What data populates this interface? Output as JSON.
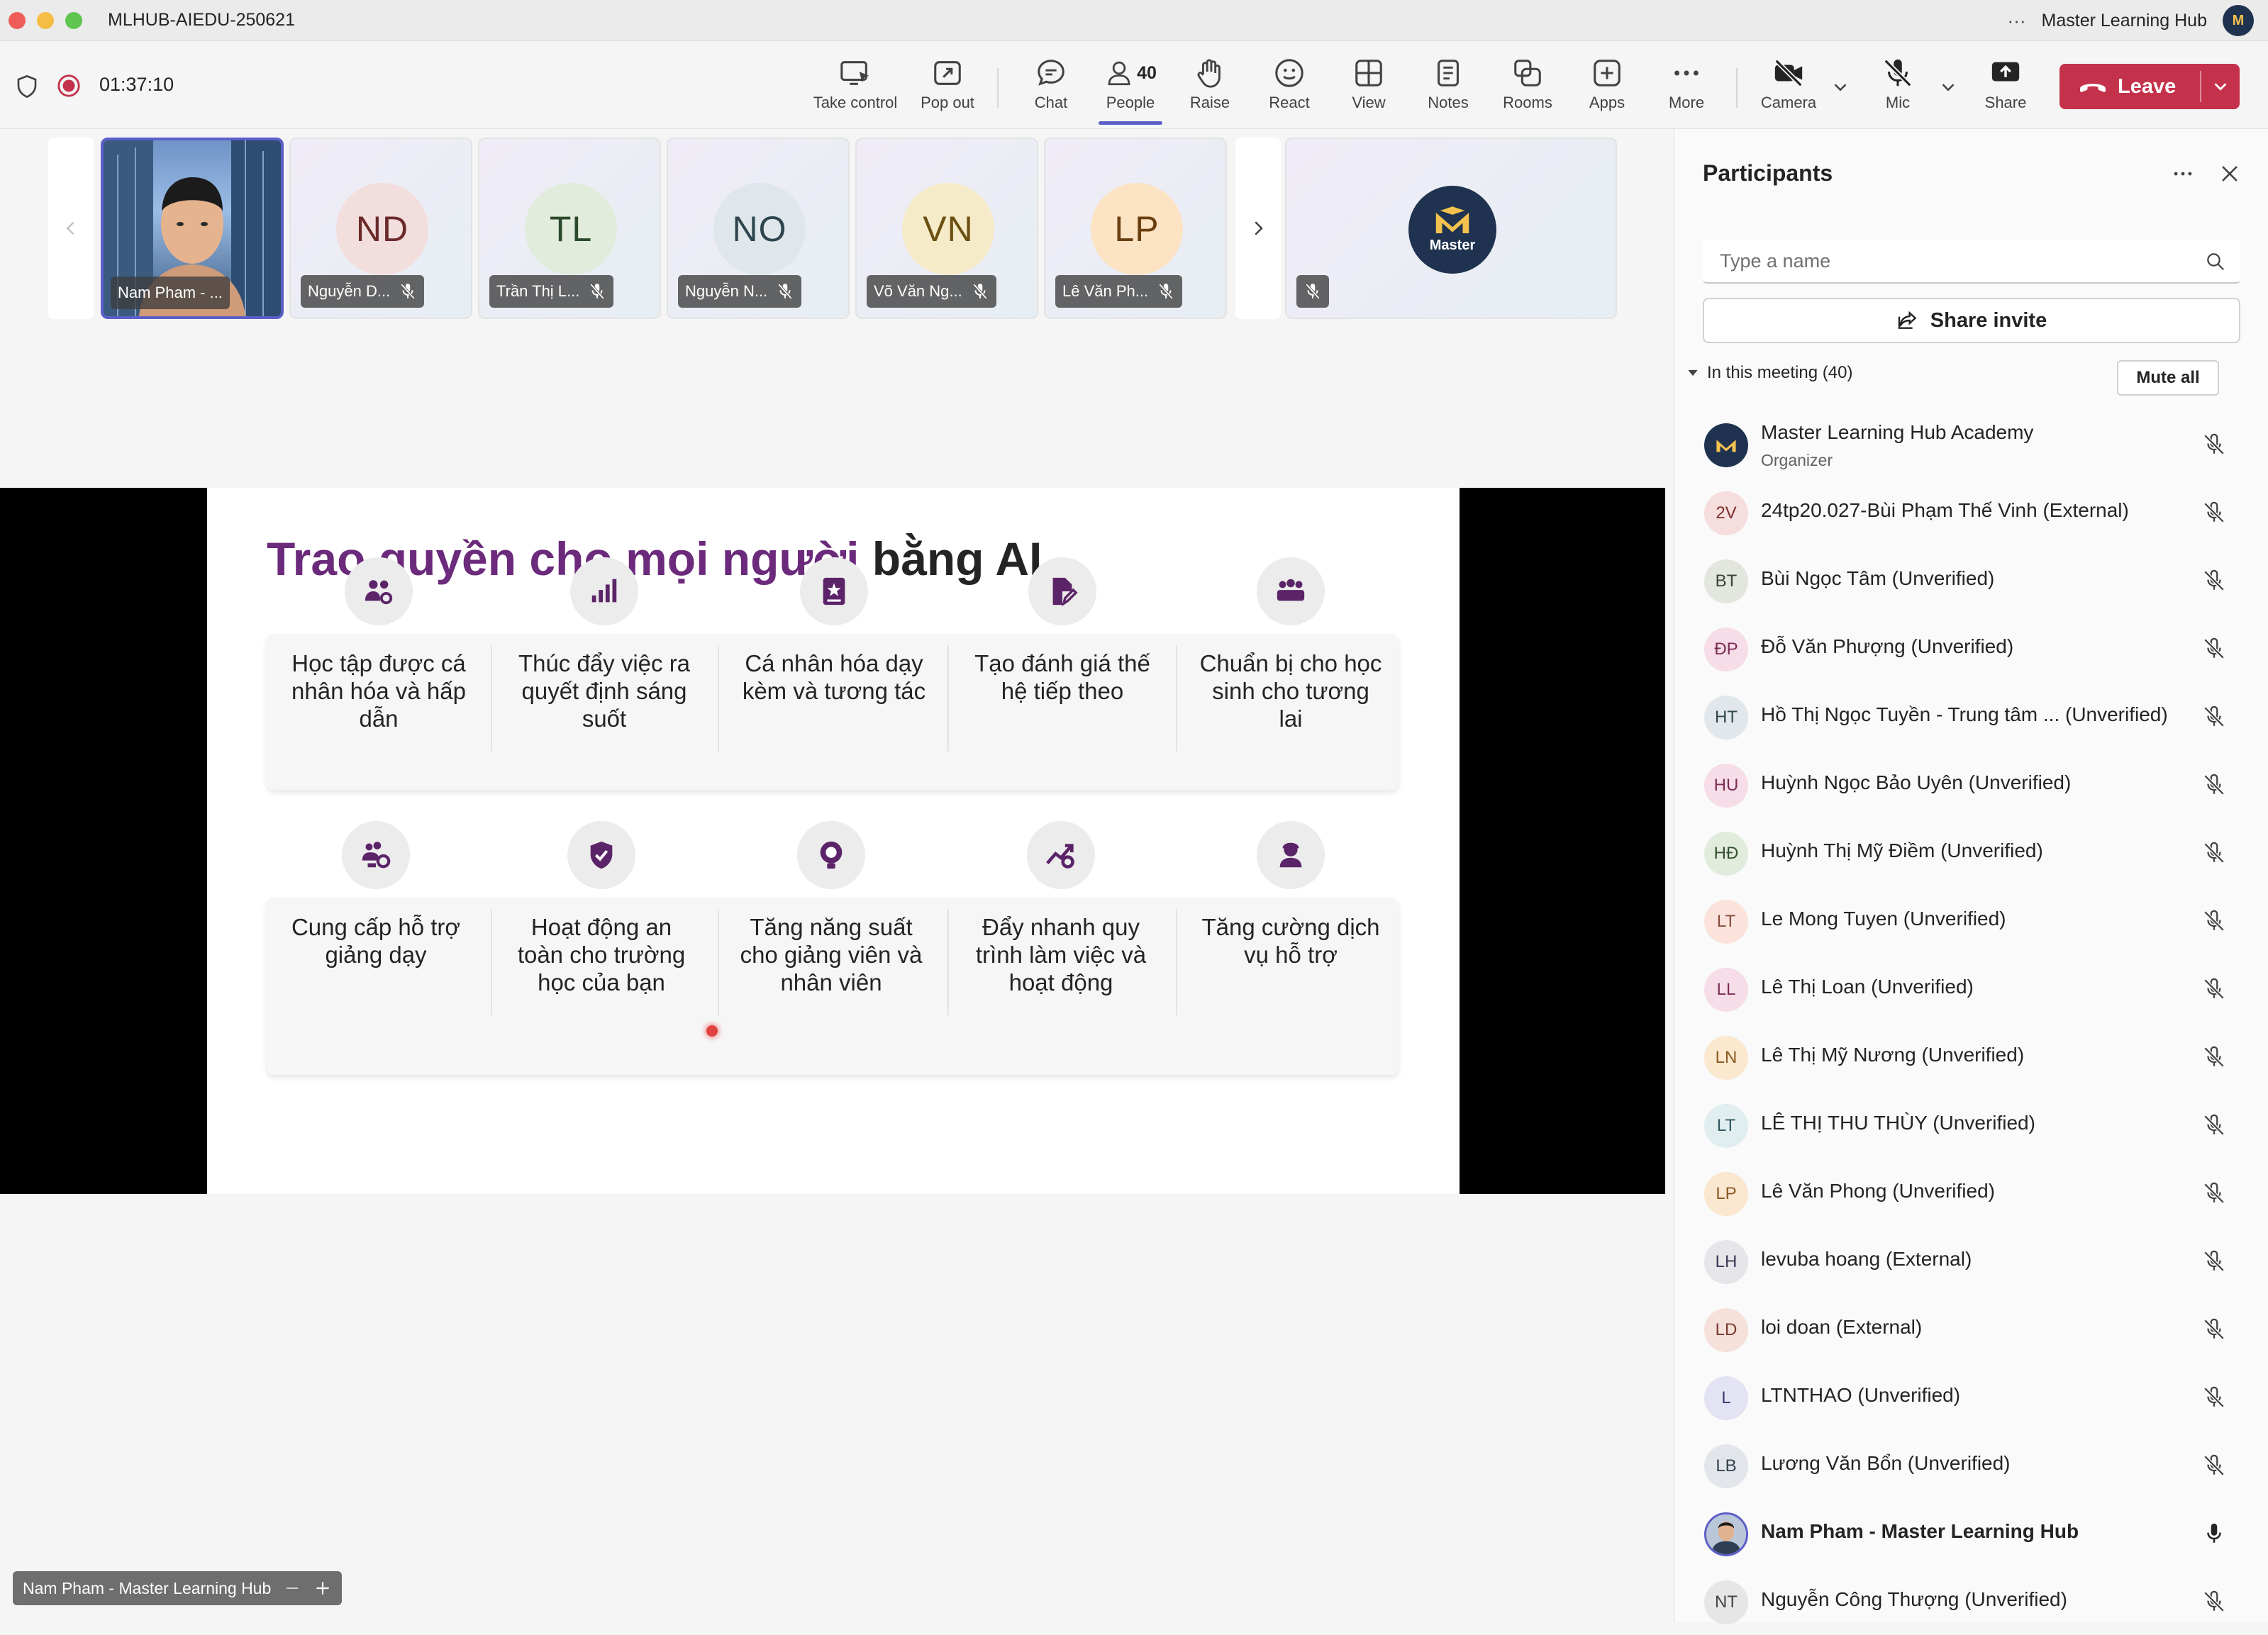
{
  "window": {
    "title": "MLHUB-AIEDU-250621",
    "org_name": "Master Learning Hub",
    "more_glyph": "···"
  },
  "toolbar": {
    "timer": "01:37:10",
    "people_count": "40",
    "buttons": {
      "take_control": "Take control",
      "pop_out": "Pop out",
      "chat": "Chat",
      "people": "People",
      "raise": "Raise",
      "react": "React",
      "view": "View",
      "notes": "Notes",
      "rooms": "Rooms",
      "apps": "Apps",
      "more": "More",
      "camera": "Camera",
      "mic": "Mic",
      "share": "Share"
    },
    "leave_label": "Leave",
    "colors": {
      "leave": "#c4314b",
      "accent": "#5b5fc7"
    }
  },
  "gallery": {
    "tiles": [
      {
        "initials": "",
        "name": "Nam Pham - ...",
        "video": true
      },
      {
        "initials": "ND",
        "name": "Nguyễn D...",
        "bg": "#f3dede",
        "fg": "#6b2a2a"
      },
      {
        "initials": "TL",
        "name": "Trần Thị L...",
        "bg": "#e2ecdd",
        "fg": "#2b4a2b"
      },
      {
        "initials": "NO",
        "name": "Nguyễn N...",
        "bg": "#dfe7ea",
        "fg": "#2f4550"
      },
      {
        "initials": "VN",
        "name": "Võ Văn Ng...",
        "bg": "#f6ebc9",
        "fg": "#6a4f10"
      },
      {
        "initials": "LP",
        "name": "Lê Văn Ph...",
        "bg": "#fbe3c4",
        "fg": "#6b3f10"
      }
    ],
    "logo_text": "Master"
  },
  "slide": {
    "title_purple": "Trao quyền cho mọi người",
    "title_dark": "bằng AI",
    "row1": [
      {
        "icon": "people-gear-icon",
        "label": "Học tập được cá nhân hóa và hấp dẫn"
      },
      {
        "icon": "bar-chart-icon",
        "label": "Thúc đẩy việc ra quyết định sáng suốt"
      },
      {
        "icon": "book-star-icon",
        "label": "Cá nhân hóa dạy kèm và tương tác"
      },
      {
        "icon": "document-edit-icon",
        "label": "Tạo đánh giá thế hệ tiếp theo"
      },
      {
        "icon": "group-icon",
        "label": "Chuẩn bị cho học sinh cho tương lai"
      }
    ],
    "row2": [
      {
        "icon": "people-settings-icon",
        "label": "Cung cấp hỗ trợ giảng dạy"
      },
      {
        "icon": "shield-check-icon",
        "label": "Hoạt động an toàn cho trường học của bạn"
      },
      {
        "icon": "lightbulb-icon",
        "label": "Tăng năng suất cho giảng viên và nhân viên"
      },
      {
        "icon": "trend-gear-icon",
        "label": "Đẩy nhanh quy trình làm việc và hoạt động"
      },
      {
        "icon": "support-person-icon",
        "label": "Tăng cường dịch vụ hỗ trợ"
      }
    ],
    "colors": {
      "title_purple": "#6b2a7b",
      "icon": "#5b2468"
    }
  },
  "self_view": {
    "name": "Nam Pham - Master Learning Hub"
  },
  "panel": {
    "title": "Participants",
    "search_placeholder": "Type a name",
    "share_invite": "Share invite",
    "section_label": "In this meeting (40)",
    "mute_all": "Mute all",
    "participants": [
      {
        "initials": "M",
        "name": "Master Learning Hub Academy",
        "sub": "Organizer",
        "bg": "#1f3350",
        "fg": "#f2c14e",
        "mic": "off"
      },
      {
        "initials": "2V",
        "name": "24tp20.027-Bùi Phạm Thế Vinh (External)",
        "bg": "#f7dede",
        "fg": "#7a2e2e",
        "mic": "off"
      },
      {
        "initials": "BT",
        "name": "Bùi Ngọc Tâm (Unverified)",
        "bg": "#e3e6df",
        "fg": "#3b4233",
        "mic": "off"
      },
      {
        "initials": "ĐP",
        "name": "Đỗ Văn Phượng (Unverified)",
        "bg": "#f6dde8",
        "fg": "#7a2e55",
        "mic": "off"
      },
      {
        "initials": "HT",
        "name": "Hồ Thị Ngọc Tuyền - Trung tâm ... (Unverified)",
        "bg": "#e1e7ea",
        "fg": "#33474f",
        "mic": "off"
      },
      {
        "initials": "HU",
        "name": "Huỳnh Ngọc Bảo Uyên (Unverified)",
        "bg": "#f6dde8",
        "fg": "#7a2e55",
        "mic": "off"
      },
      {
        "initials": "HĐ",
        "name": "Huỳnh Thị Mỹ Điềm (Unverified)",
        "bg": "#e2ecdd",
        "fg": "#35502f",
        "mic": "off"
      },
      {
        "initials": "LT",
        "name": "Le Mong Tuyen (Unverified)",
        "bg": "#fbe3dc",
        "fg": "#8a4a3a",
        "mic": "off"
      },
      {
        "initials": "LL",
        "name": "Lê Thị Loan (Unverified)",
        "bg": "#f6dde8",
        "fg": "#7a2e55",
        "mic": "off"
      },
      {
        "initials": "LN",
        "name": "Lê Thị Mỹ Nương (Unverified)",
        "bg": "#fbe8cf",
        "fg": "#8a5a20",
        "mic": "off"
      },
      {
        "initials": "LT",
        "name": "LÊ THỊ THU THÙY (Unverified)",
        "bg": "#e1eef0",
        "fg": "#2e5a60",
        "mic": "off"
      },
      {
        "initials": "LP",
        "name": "Lê Văn Phong (Unverified)",
        "bg": "#fbe6cf",
        "fg": "#8a5a20",
        "mic": "off"
      },
      {
        "initials": "LH",
        "name": "levuba hoang (External)",
        "bg": "#e5e5ea",
        "fg": "#3a3a55",
        "mic": "off"
      },
      {
        "initials": "LD",
        "name": "loi doan (External)",
        "bg": "#f6e0da",
        "fg": "#7a3a2e",
        "mic": "off"
      },
      {
        "initials": "L",
        "name": "LTNTHAO (Unverified)",
        "bg": "#e3e3f3",
        "fg": "#3a3a70",
        "mic": "off"
      },
      {
        "initials": "LB",
        "name": "Lương Văn Bổn (Unverified)",
        "bg": "#e2e6ea",
        "fg": "#33404f",
        "mic": "off"
      },
      {
        "initials": "",
        "name": "Nam Pham - Master Learning Hub",
        "bg": "#c9d4e3",
        "fg": "#333",
        "mic": "on",
        "photo": true,
        "bold": true
      },
      {
        "initials": "NT",
        "name": "Nguyễn Công Thượng (Unverified)",
        "bg": "#e6e6e6",
        "fg": "#444",
        "mic": "off"
      }
    ]
  }
}
